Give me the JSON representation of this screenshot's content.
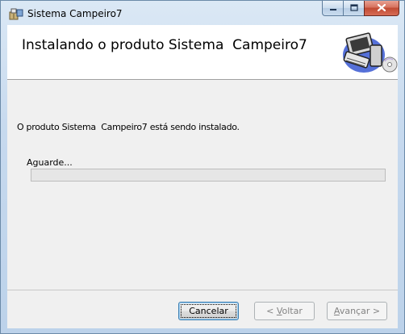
{
  "window": {
    "title": "Sistema  Campeiro7",
    "icon": "installer-package-icon",
    "caption_buttons": {
      "minimize": "minimize-icon",
      "maximize": "maximize-icon",
      "close": "close-icon"
    }
  },
  "banner": {
    "title": "Instalando o produto Sistema  Campeiro7",
    "graphic": "computer-with-cd-icon"
  },
  "body": {
    "status_text": "O produto Sistema  Campeiro7 está sendo instalado.",
    "wait_label": "Aguarde...",
    "progress_fraction": 0
  },
  "footer": {
    "cancel_label": "Cancelar",
    "back_accel": "V",
    "back_rest": "oltar",
    "back_prefix": "< ",
    "next_accel": "A",
    "next_rest": "vançar",
    "next_suffix": " >"
  },
  "colors": {
    "client_bg": "#f0f0f0",
    "progress_fill": "#3cb043"
  }
}
